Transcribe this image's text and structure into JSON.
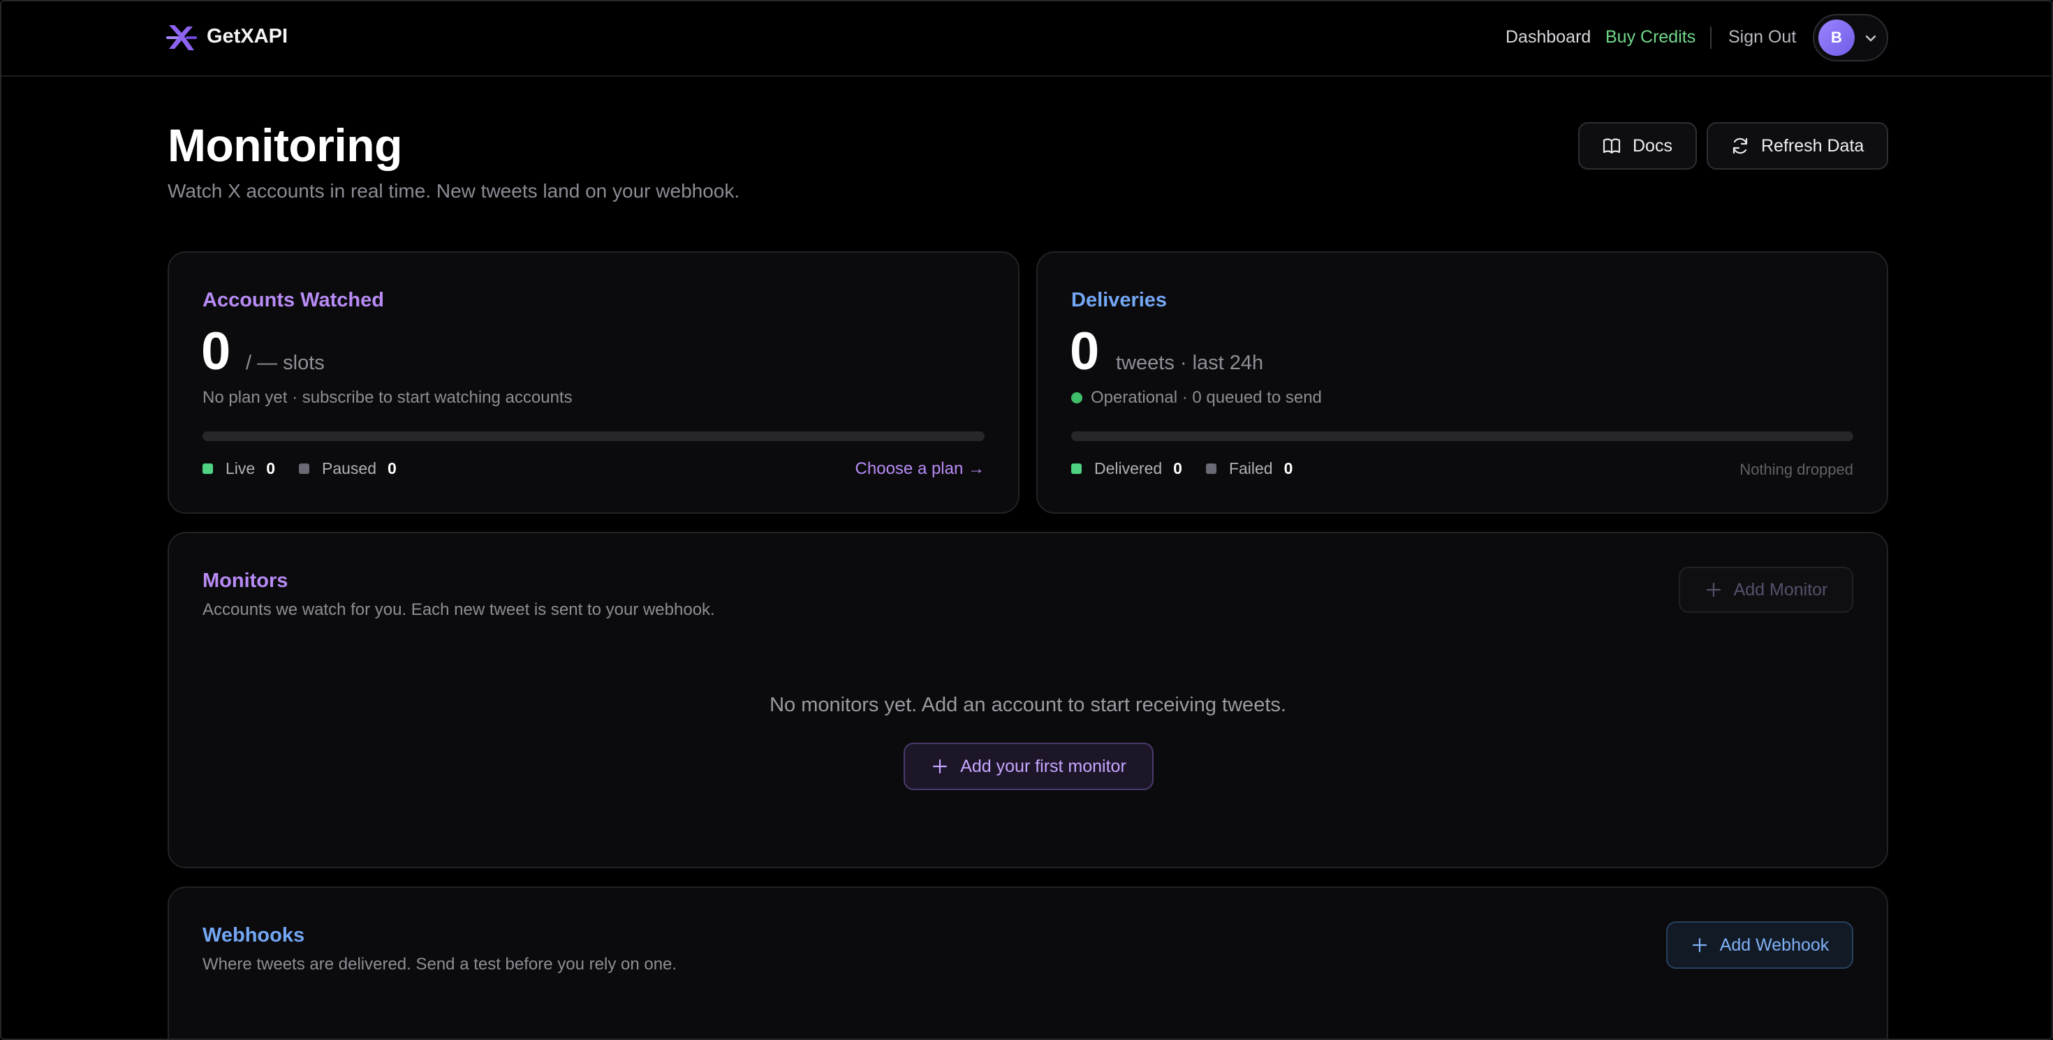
{
  "nav": {
    "brand": "GetXAPI",
    "links": {
      "dashboard": "Dashboard",
      "buy_credits": "Buy Credits",
      "sign_out": "Sign Out"
    },
    "avatar_initial": "B"
  },
  "header": {
    "title": "Monitoring",
    "subtitle": "Watch X accounts in real time. New tweets land on your webhook.",
    "docs_label": "Docs",
    "refresh_label": "Refresh Data"
  },
  "accounts": {
    "title": "Accounts Watched",
    "count": "0",
    "unit": "/ — slots",
    "subtitle": "No plan yet · subscribe to start watching accounts",
    "progress_fraction": 0,
    "legend": {
      "live_label": "Live",
      "live_value": "0",
      "paused_label": "Paused",
      "paused_value": "0"
    },
    "cta": "Choose a plan →"
  },
  "deliveries": {
    "title": "Deliveries",
    "count": "0",
    "unit": "tweets · last 24h",
    "status": "Operational · 0 queued to send",
    "progress_fraction": 0,
    "legend": {
      "delivered_label": "Delivered",
      "delivered_value": "0",
      "failed_label": "Failed",
      "failed_value": "0"
    },
    "note": "Nothing dropped"
  },
  "monitors": {
    "title": "Monitors",
    "subtitle": "Accounts we watch for you. Each new tweet is sent to your webhook.",
    "add_label": "Add Monitor",
    "empty_message": "No monitors yet. Add an account to start receiving tweets.",
    "first_label": "Add your first monitor"
  },
  "webhooks": {
    "title": "Webhooks",
    "subtitle": "Where tweets are delivered. Send a test before you rely on one.",
    "add_label": "Add Webhook"
  },
  "colors": {
    "accent_purple": "#b88bf5",
    "accent_blue": "#74a7f5",
    "accent_green": "#6fd98a",
    "background": "#000000",
    "card": "#0b0b0d"
  },
  "icons": {
    "logo": "getxapi-logo-icon",
    "docs": "book-icon",
    "refresh": "refresh-icon",
    "plus": "plus-icon",
    "menu": "chevron-down-icon"
  }
}
